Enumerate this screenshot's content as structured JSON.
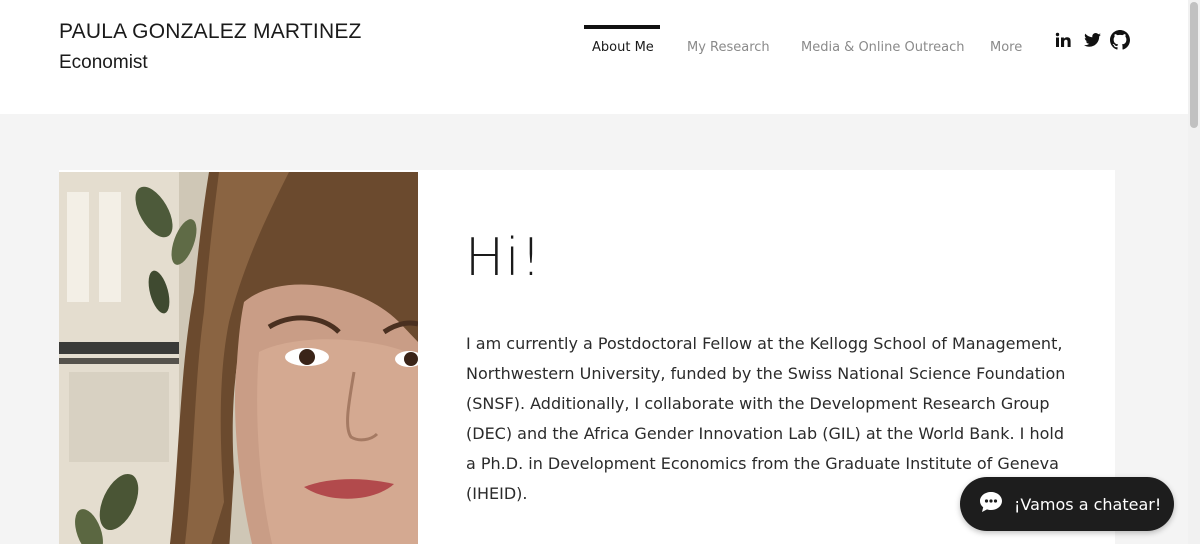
{
  "header": {
    "site_name": "PAULA GONZALEZ MARTINEZ",
    "site_role": "Economist"
  },
  "nav": {
    "items": [
      {
        "label": "About Me",
        "active": true
      },
      {
        "label": "My Research",
        "active": false
      },
      {
        "label": "Media & Online Outreach",
        "active": false
      },
      {
        "label": "More",
        "active": false
      }
    ]
  },
  "social": {
    "icons": [
      "linkedin-icon",
      "twitter-icon",
      "github-icon"
    ]
  },
  "main": {
    "greeting": "Hi!",
    "bio": "I am currently a Postdoctoral Fellow at the Kellogg School of Management, Northwestern University, funded by the Swiss National Science Foundation (SNSF). Additionally, I collaborate with the Development Research Group (DEC) and the Africa Gender Innovation Lab (GIL) at the World Bank. I hold a Ph.D. in Development Economics from the Graduate Institute of Geneva (IHEID)."
  },
  "chat": {
    "label": "¡Vamos a chatear!"
  },
  "colors": {
    "page_background": "#f4f4f4",
    "text_dark": "#1a1a1a",
    "nav_inactive": "#8a8a8a",
    "chat_background": "#1d1d1d"
  }
}
